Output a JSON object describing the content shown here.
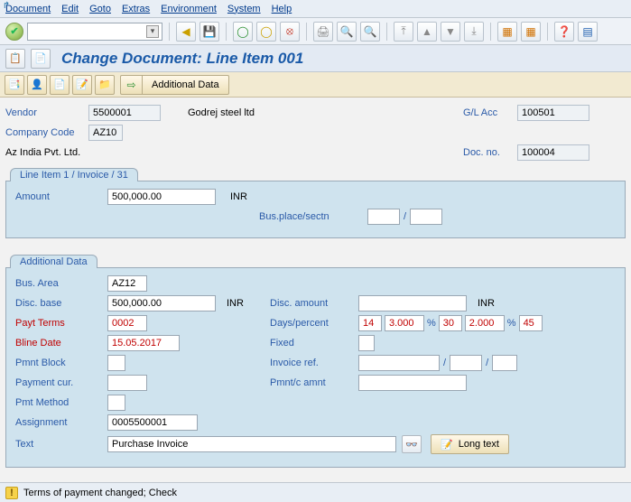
{
  "menu": {
    "document": "Document",
    "edit": "Edit",
    "goto": "Goto",
    "extras": "Extras",
    "environment": "Environment",
    "system": "System",
    "help": "Help"
  },
  "title": "Change Document: Line Item 001",
  "subtoolbar": {
    "additional_data": "Additional Data"
  },
  "header": {
    "vendor_label": "Vendor",
    "vendor": "5500001",
    "vendor_name": "Godrej steel ltd",
    "glacc_label": "G/L Acc",
    "glacc": "100501",
    "company_label": "Company Code",
    "company": "AZ10",
    "company_name": "Az India Pvt. Ltd.",
    "docno_label": "Doc. no.",
    "docno": "100004"
  },
  "group1": {
    "tab": "Line Item 1 / Invoice / 31",
    "amount_label": "Amount",
    "amount": "500,000.00",
    "amount_cur": "INR",
    "busplace_label": "Bus.place/sectn",
    "busplace": "",
    "sectn": ""
  },
  "group2": {
    "tab": "Additional Data",
    "busarea_label": "Bus. Area",
    "busarea": "AZ12",
    "discbase_label": "Disc. base",
    "discbase": "500,000.00",
    "discbase_cur": "INR",
    "discamount_label": "Disc. amount",
    "discamount": "",
    "discamount_cur": "INR",
    "payt_label": "Payt Terms",
    "payt": "0002",
    "dayspct_label": "Days/percent",
    "d1": "14",
    "p1": "3.000",
    "d2": "30",
    "p2": "2.000",
    "d3": "45",
    "bline_label": "Bline Date",
    "bline": "15.05.2017",
    "fixed_label": "Fixed",
    "fixed": "",
    "pmntblock_label": "Pmnt Block",
    "pmntblock": "",
    "invref_label": "Invoice ref.",
    "invref1": "",
    "invref2": "",
    "invref3": "",
    "paycur_label": "Payment cur.",
    "paycur": "",
    "paycur_amt": "",
    "pmntc_label": "Pmnt/c amnt",
    "pmntc": "",
    "pmtmethod_label": "Pmt Method",
    "pmtmethod": "",
    "assignment_label": "Assignment",
    "assignment": "0005500001",
    "text_label": "Text",
    "text": "Purchase Invoice",
    "longtext_btn": "Long text"
  },
  "status": "Terms of payment changed; Check"
}
